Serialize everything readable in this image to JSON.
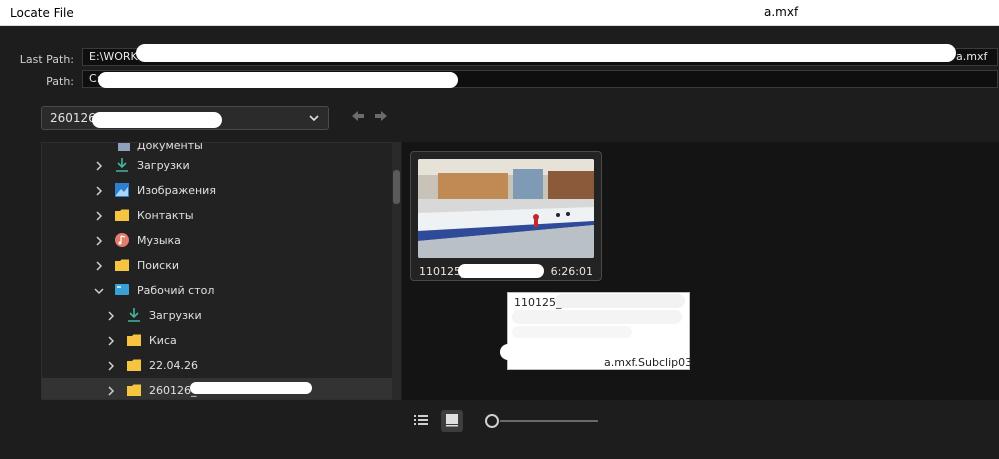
{
  "window": {
    "title": "Locate File",
    "title_suffix": "a.mxf"
  },
  "paths": {
    "last_path_label": "Last Path:",
    "last_path_value": "E:\\WORK",
    "last_path_suffix": "a.mxf",
    "path_label": "Path:",
    "path_value": "C:\\"
  },
  "location_dropdown": {
    "selected": "260126_"
  },
  "tree": {
    "items": [
      {
        "label": "Документы",
        "icon": "documents-icon",
        "indent": 1
      },
      {
        "label": "Загрузки",
        "icon": "download-icon",
        "indent": 1
      },
      {
        "label": "Изображения",
        "icon": "images-icon",
        "indent": 1
      },
      {
        "label": "Контакты",
        "icon": "folder-icon",
        "indent": 1
      },
      {
        "label": "Музыка",
        "icon": "music-icon",
        "indent": 1
      },
      {
        "label": "Поиски",
        "icon": "folder-icon",
        "indent": 1
      },
      {
        "label": "Рабочий стол",
        "icon": "desktop-icon",
        "indent": 1,
        "expanded": true
      },
      {
        "label": "Загрузки",
        "icon": "download-icon",
        "indent": 2
      },
      {
        "label": "Киса",
        "icon": "folder-icon",
        "indent": 2
      },
      {
        "label": "22.04.26",
        "icon": "folder-icon",
        "indent": 2
      },
      {
        "label": "260126_",
        "icon": "folder-icon",
        "indent": 2,
        "selected": true
      }
    ]
  },
  "clip": {
    "name": "110125_",
    "duration": "6:26:01"
  },
  "tooltip": {
    "line1": "110125_",
    "line4": "a.mxf.Subclip03"
  },
  "footer": {
    "list_view_icon": "list-view-icon",
    "icon_view_icon": "icon-view-icon",
    "zoom_level": 0.0
  },
  "colors": {
    "background": "#1d1d1d",
    "panel": "#222222",
    "content": "#141414",
    "titlebar": "#ffffff"
  }
}
